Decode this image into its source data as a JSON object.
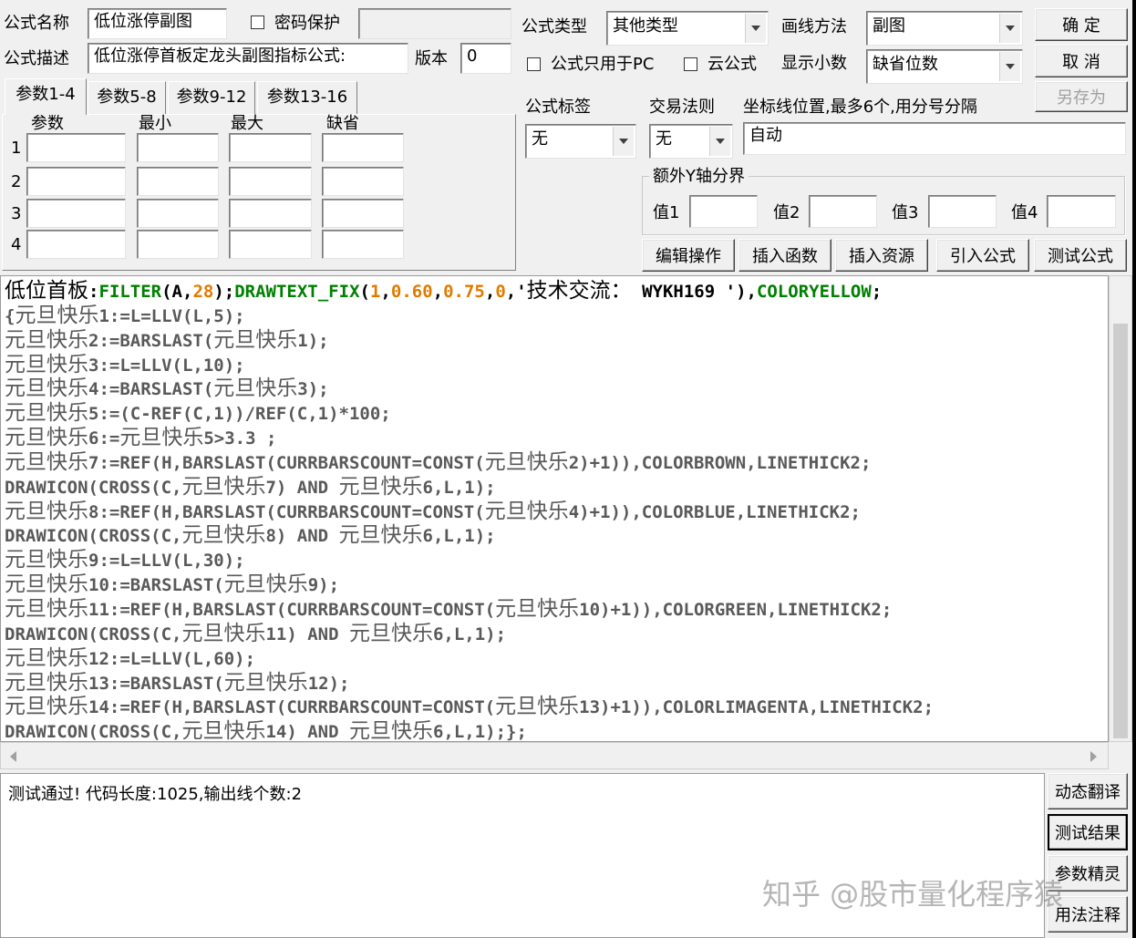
{
  "header": {
    "name_label": "公式名称",
    "name_value": "低位涨停副图",
    "password_label": "密码保护",
    "password_value": "",
    "desc_label": "公式描述",
    "desc_value": "低位涨停首板定龙头副图指标公式:",
    "version_label": "版本",
    "version_value": "0",
    "type_label": "公式类型",
    "type_value": "其他类型",
    "draw_label": "画线方法",
    "draw_value": "副图",
    "pc_only_label": "公式只用于PC",
    "cloud_label": "云公式",
    "decimal_label": "显示小数",
    "decimal_value": "缺省位数"
  },
  "buttons": {
    "ok": "确  定",
    "cancel": "取  消",
    "save_as": "另存为",
    "edit_ops": "编辑操作",
    "insert_func": "插入函数",
    "insert_res": "插入资源",
    "import_formula": "引入公式",
    "test_formula": "测试公式",
    "dyn_translate": "动态翻译",
    "test_result": "测试结果",
    "param_wizard": "参数精灵",
    "usage_note": "用法注释"
  },
  "tabs": [
    "参数1-4",
    "参数5-8",
    "参数9-12",
    "参数13-16"
  ],
  "params": {
    "headers": [
      "参数",
      "最小",
      "最大",
      "缺省"
    ],
    "rows": [
      "1",
      "2",
      "3",
      "4"
    ]
  },
  "options": {
    "tag_label": "公式标签",
    "tag_value": "无",
    "trade_label": "交易法则",
    "trade_value": "无",
    "axis_label": "坐标线位置,最多6个,用分号分隔",
    "axis_value": "自动",
    "yaxis_group": "额外Y轴分界",
    "v1": "值1",
    "v2": "值2",
    "v3": "值3",
    "v4": "值4"
  },
  "code_lines": [
    "低位首板:FILTER(A,28);DRAWTEXT_FIX(1,0.60,0.75,0,'技术交流： WYKH169 '),COLORYELLOW;",
    "{元旦快乐1:=L=LLV(L,5);",
    "元旦快乐2:=BARSLAST(元旦快乐1);",
    "元旦快乐3:=L=LLV(L,10);",
    "元旦快乐4:=BARSLAST(元旦快乐3);",
    "元旦快乐5:=(C-REF(C,1))/REF(C,1)*100;",
    "元旦快乐6:=元旦快乐5>3.3 ;",
    "元旦快乐7:=REF(H,BARSLAST(CURRBARSCOUNT=CONST(元旦快乐2)+1)),COLORBROWN,LINETHICK2;",
    "DRAWICON(CROSS(C,元旦快乐7) AND 元旦快乐6,L,1);",
    "元旦快乐8:=REF(H,BARSLAST(CURRBARSCOUNT=CONST(元旦快乐4)+1)),COLORBLUE,LINETHICK2;",
    "DRAWICON(CROSS(C,元旦快乐8) AND 元旦快乐6,L,1);",
    "元旦快乐9:=L=LLV(L,30);",
    "元旦快乐10:=BARSLAST(元旦快乐9);",
    "元旦快乐11:=REF(H,BARSLAST(CURRBARSCOUNT=CONST(元旦快乐10)+1)),COLORGREEN,LINETHICK2;",
    "DRAWICON(CROSS(C,元旦快乐11) AND 元旦快乐6,L,1);",
    "元旦快乐12:=L=LLV(L,60);",
    "元旦快乐13:=BARSLAST(元旦快乐12);",
    "元旦快乐14:=REF(H,BARSLAST(CURRBARSCOUNT=CONST(元旦快乐13)+1)),COLORLIMAGENTA,LINETHICK2;",
    "DRAWICON(CROSS(C,元旦快乐14) AND 元旦快乐6,L,1);};"
  ],
  "status": "测试通过! 代码长度:1025,输出线个数:2",
  "watermark": "知乎 @股市量化程序猿"
}
